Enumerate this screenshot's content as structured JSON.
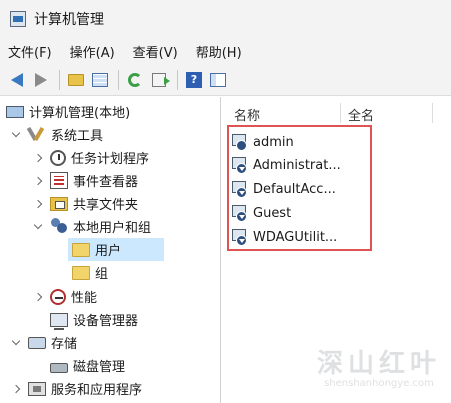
{
  "window": {
    "title": "计算机管理",
    "icon": "computer-management-icon"
  },
  "menu": [
    "文件(F)",
    "操作(A)",
    "查看(V)",
    "帮助(H)"
  ],
  "toolbar": {
    "buttons": [
      "back-icon",
      "forward-icon",
      "up-folder-icon",
      "show-hide-tree-icon",
      "refresh-icon",
      "export-list-icon",
      "help-icon",
      "properties-icon"
    ]
  },
  "tree": {
    "root": "计算机管理(本地)",
    "system_tools": "系统工具",
    "task_scheduler": "任务计划程序",
    "event_viewer": "事件查看器",
    "shared_folders": "共享文件夹",
    "local_users_groups": "本地用户和组",
    "users": "用户",
    "groups": "组",
    "performance": "性能",
    "device_manager": "设备管理器",
    "storage": "存储",
    "disk_management": "磁盘管理",
    "services_apps": "服务和应用程序"
  },
  "list": {
    "columns": [
      "名称",
      "全名"
    ],
    "rows": [
      "admin",
      "Administrat...",
      "DefaultAcc...",
      "Guest",
      "WDAGUtilit..."
    ]
  },
  "watermark": {
    "main": "深山红叶",
    "sub": "shenshanhongye.com"
  },
  "colors": {
    "selection": "#cce8ff",
    "highlight_box": "#e05353",
    "folder": "#f2d56a"
  }
}
